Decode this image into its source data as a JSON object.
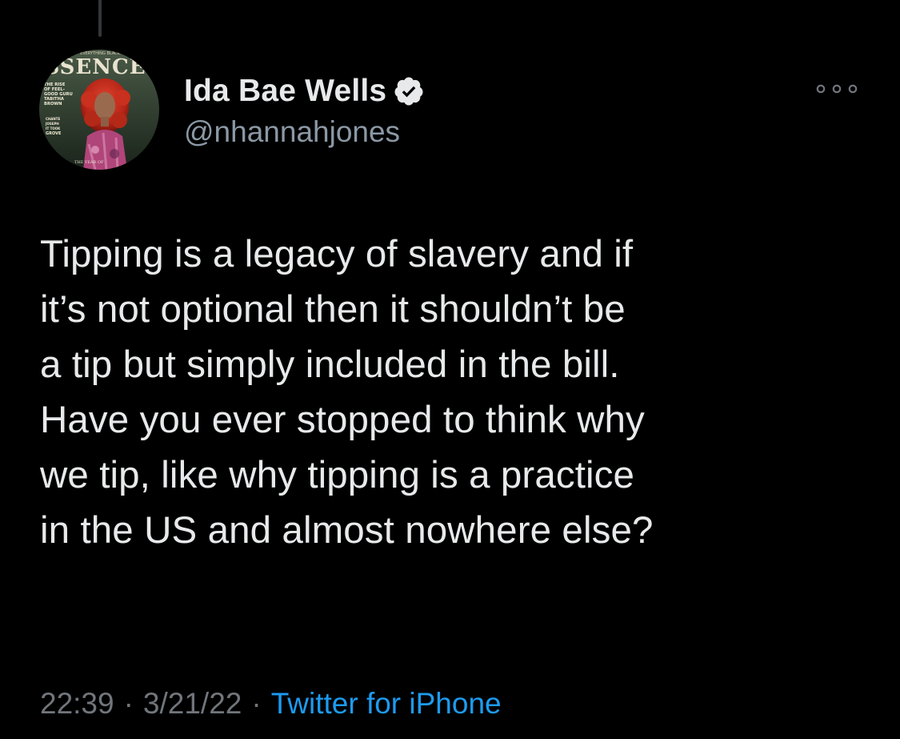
{
  "author": {
    "display_name": "Ida Bae Wells",
    "handle": "@nhannahjones",
    "verified": true,
    "avatar": {
      "description": "magazine-cover-avatar",
      "masthead": "SSENCE",
      "cover_lines": [
        "THE RISE",
        "OF FEEL-",
        "GOOD GURU",
        "TABITHA",
        "BROWN"
      ],
      "cover_lines_lower": [
        "CHANTE",
        "JOSEPH",
        "IT TOOK",
        "GROVE"
      ],
      "footer": "THE YEAR OF",
      "top_banner": "EVERYTHING BLACK"
    }
  },
  "tweet": {
    "text": "Tipping is a legacy of slavery and if\nit’s not optional then it shouldn’t be\na tip but simply included in the bill.\nHave you ever stopped to think why\nwe tip, like why tipping is a practice\nin the US and almost nowhere else?"
  },
  "meta": {
    "time": "22:39",
    "date": "3/21/22",
    "separator": "·",
    "source": "Twitter for iPhone"
  },
  "icons": {
    "verified": "verified-badge-icon",
    "more": "more-options-icon"
  },
  "colors": {
    "background": "#000000",
    "text_primary": "#e7e9ea",
    "text_secondary": "#71767b",
    "link": "#1d9bf0",
    "thread_line": "#333639"
  }
}
